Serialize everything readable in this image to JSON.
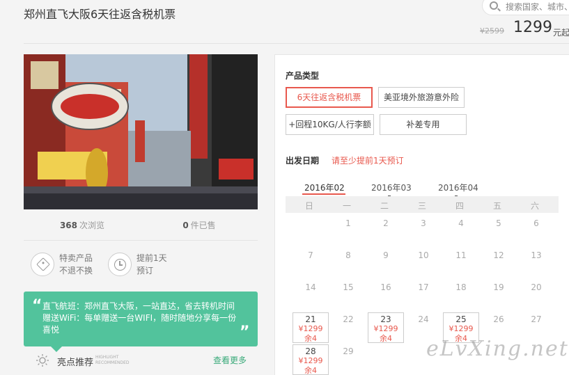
{
  "page": {
    "title": "郑州直飞大阪6天往返含税机票"
  },
  "search": {
    "placeholder": "搜索国家、城市、"
  },
  "price": {
    "original": "¥2599",
    "current": "1299",
    "unit": "元起"
  },
  "stats": {
    "views_count": "368",
    "views_label": "次浏览",
    "sold_count": "0",
    "sold_label": "件已售"
  },
  "features": [
    {
      "icon": "tag-icon",
      "line1": "特卖产品",
      "line2": "不退不换"
    },
    {
      "icon": "clock-icon",
      "line1": "提前1天",
      "line2": "预订"
    }
  ],
  "quote": {
    "lines": [
      "直飞航班：郑州直飞大阪，一站直达，省去转机时间",
      "赠送WiFi：每单赠送一台WIFI，随时随地分享每一份",
      "喜悦"
    ]
  },
  "highlight": {
    "title": "亮点推荐",
    "en1": "HIGHLIGHT",
    "en2": "RECOMMENDED",
    "more": "查看更多"
  },
  "product_type": {
    "label": "产品类型",
    "options": [
      "6天往返含税机票",
      "美亚境外旅游意外险",
      "+回程10KG/人行李额",
      "补差专用"
    ],
    "selected": 0
  },
  "departure": {
    "label": "出发日期",
    "note": "请至少提前1天预订"
  },
  "months": [
    "2016年02",
    "2016年03",
    "2016年04"
  ],
  "weekdays": [
    "日",
    "一",
    "二",
    "三",
    "四",
    "五",
    "六"
  ],
  "calendar": {
    "days": [
      "1",
      "2",
      "3",
      "4",
      "5",
      "6",
      "7",
      "8",
      "9",
      "10",
      "11",
      "12",
      "13",
      "14",
      "15",
      "16",
      "17",
      "18",
      "19",
      "20",
      "21",
      "22",
      "23",
      "24",
      "25",
      "26",
      "27",
      "28",
      "29"
    ],
    "available": {
      "21": {
        "price": "¥1299",
        "remain": "余4"
      },
      "23": {
        "price": "¥1299",
        "remain": "余4"
      },
      "25": {
        "price": "¥1299",
        "remain": "余4"
      },
      "28": {
        "price": "¥1299",
        "remain": "余4"
      }
    }
  },
  "watermark": "eLvXing.net",
  "colors": {
    "accent": "#e8584d",
    "quote_bg": "#52c39c",
    "link_green": "#3aaa7a"
  }
}
